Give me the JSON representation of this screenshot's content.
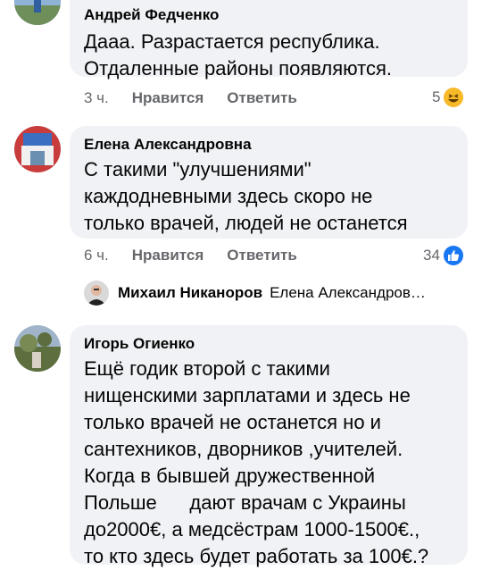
{
  "comments": [
    {
      "author": "Андрей Федченко",
      "text": "Дааа. Разрастается республика.\nОтдаленные районы появляются.",
      "time": "3 ч.",
      "like_label": "Нравится",
      "reply_label": "Ответить",
      "reaction_count": "5",
      "reaction_icon": "laugh-emoji-icon"
    },
    {
      "author": "Елена Александровна",
      "text": "С такими \"улучшениями\"\nкаждодневными здесь скоро не\nтолько врачей, людей не останется",
      "time": "6 ч.",
      "like_label": "Нравится",
      "reply_label": "Ответить",
      "reaction_count": "34",
      "reaction_icon": "like-thumb-icon"
    },
    {
      "author": "Игорь Огиенко",
      "text": "Ещё годик второй с такими\nнищенскими зарплатами и здесь не\nтолько врачей не останется но и\nсантехников, дворников ,учителей.\nКогда в бывшей дружественной\nПольше      дают врачам с Украины\nдо2000€, а медсёстрам 1000-1500€.,\nто кто здесь будет работать за 100€.?"
    }
  ],
  "reply_preview": {
    "author": "Михаил Никаноров",
    "text": "Елена Александров…"
  },
  "colors": {
    "bubble": "#f0f2f5",
    "meta": "#65676b",
    "like_blue": "#1877f2",
    "laugh_yellow": "#f7b928"
  }
}
